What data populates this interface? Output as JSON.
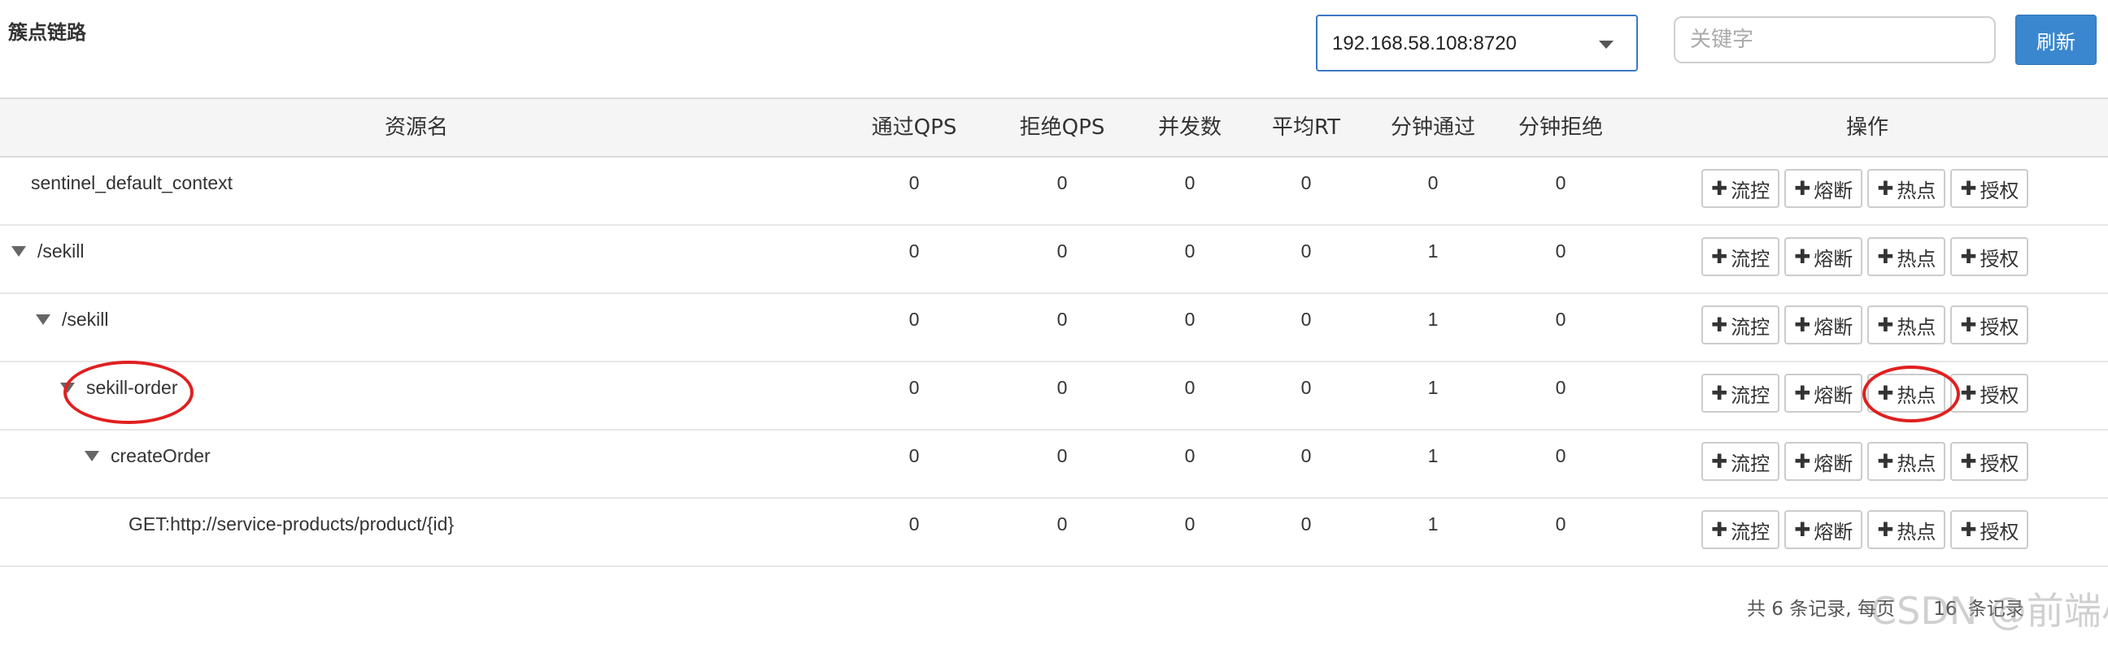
{
  "page_title": "簇点链路",
  "toolbar": {
    "machine_value": "192.168.58.108:8720",
    "keyword_placeholder": "关键字",
    "refresh_label": "刷新"
  },
  "table": {
    "headers": {
      "name": "资源名",
      "pass_qps": "通过QPS",
      "block_qps": "拒绝QPS",
      "concurrency": "并发数",
      "avg_rt": "平均RT",
      "minute_pass": "分钟通过",
      "minute_block": "分钟拒绝",
      "ops": "操作"
    },
    "op_labels": {
      "flow": "流控",
      "degrade": "熔断",
      "hot": "热点",
      "auth": "授权"
    },
    "rows": [
      {
        "name": "sentinel_default_context",
        "pass_qps": "0",
        "block_qps": "0",
        "concurrency": "0",
        "avg_rt": "0",
        "minute_pass": "0",
        "minute_block": "0"
      },
      {
        "name": "/sekill",
        "pass_qps": "0",
        "block_qps": "0",
        "concurrency": "0",
        "avg_rt": "0",
        "minute_pass": "1",
        "minute_block": "0"
      },
      {
        "name": "/sekill",
        "pass_qps": "0",
        "block_qps": "0",
        "concurrency": "0",
        "avg_rt": "0",
        "minute_pass": "1",
        "minute_block": "0"
      },
      {
        "name": "sekill-order",
        "pass_qps": "0",
        "block_qps": "0",
        "concurrency": "0",
        "avg_rt": "0",
        "minute_pass": "1",
        "minute_block": "0"
      },
      {
        "name": "createOrder",
        "pass_qps": "0",
        "block_qps": "0",
        "concurrency": "0",
        "avg_rt": "0",
        "minute_pass": "1",
        "minute_block": "0"
      },
      {
        "name": "GET:http://service-products/product/{id}",
        "pass_qps": "0",
        "block_qps": "0",
        "concurrency": "0",
        "avg_rt": "0",
        "minute_pass": "1",
        "minute_block": "0"
      }
    ]
  },
  "pager": {
    "summary": "共 6 条记录, 每页",
    "page_size": "16",
    "suffix": "条记录"
  },
  "watermark": "CSDN @前端小马",
  "colors": {
    "accent": "#3a87cf",
    "annotation": "#e02020"
  }
}
